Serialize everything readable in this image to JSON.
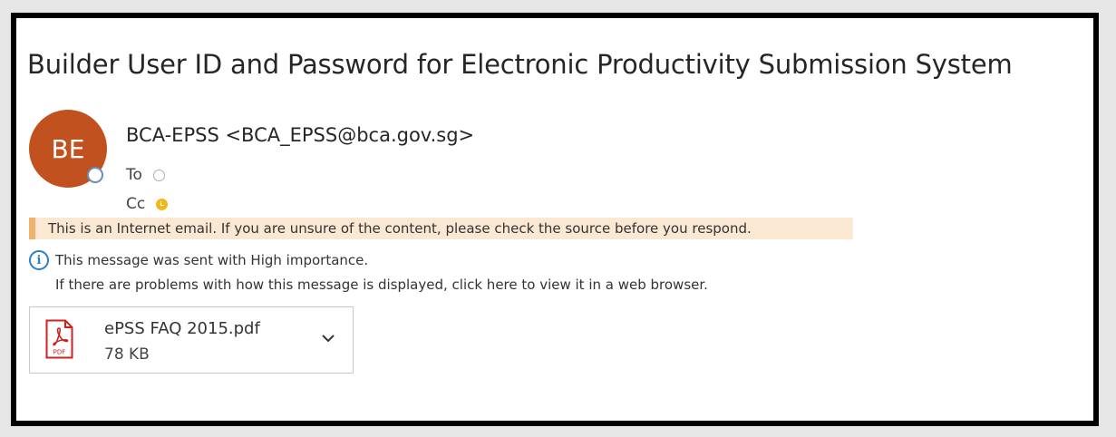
{
  "email": {
    "subject": "Builder User ID and Password for Electronic Productivity Submission System",
    "sender": {
      "initials": "BE",
      "display": "BCA-EPSS <BCA_EPSS@bca.gov.sg>",
      "avatar_color": "#c1521f"
    },
    "recipients": {
      "to_label": "To",
      "cc_label": "Cc"
    },
    "warning_banner": "This is an Internet email. If you are unsure of the content, please check the source before you respond.",
    "info": {
      "importance": "This message was sent with High importance.",
      "display_problem": "If there are problems with how this message is displayed, click here to view it in a web browser."
    },
    "attachment": {
      "icon": "pdf-icon",
      "icon_label": "PDF",
      "name": "ePSS FAQ 2015.pdf",
      "size": "78 KB"
    }
  },
  "colors": {
    "warning_bg": "#fbe8d3",
    "warning_accent": "#f1b26c",
    "info_blue": "#2a7fc8",
    "pdf_red": "#d21f1f"
  }
}
